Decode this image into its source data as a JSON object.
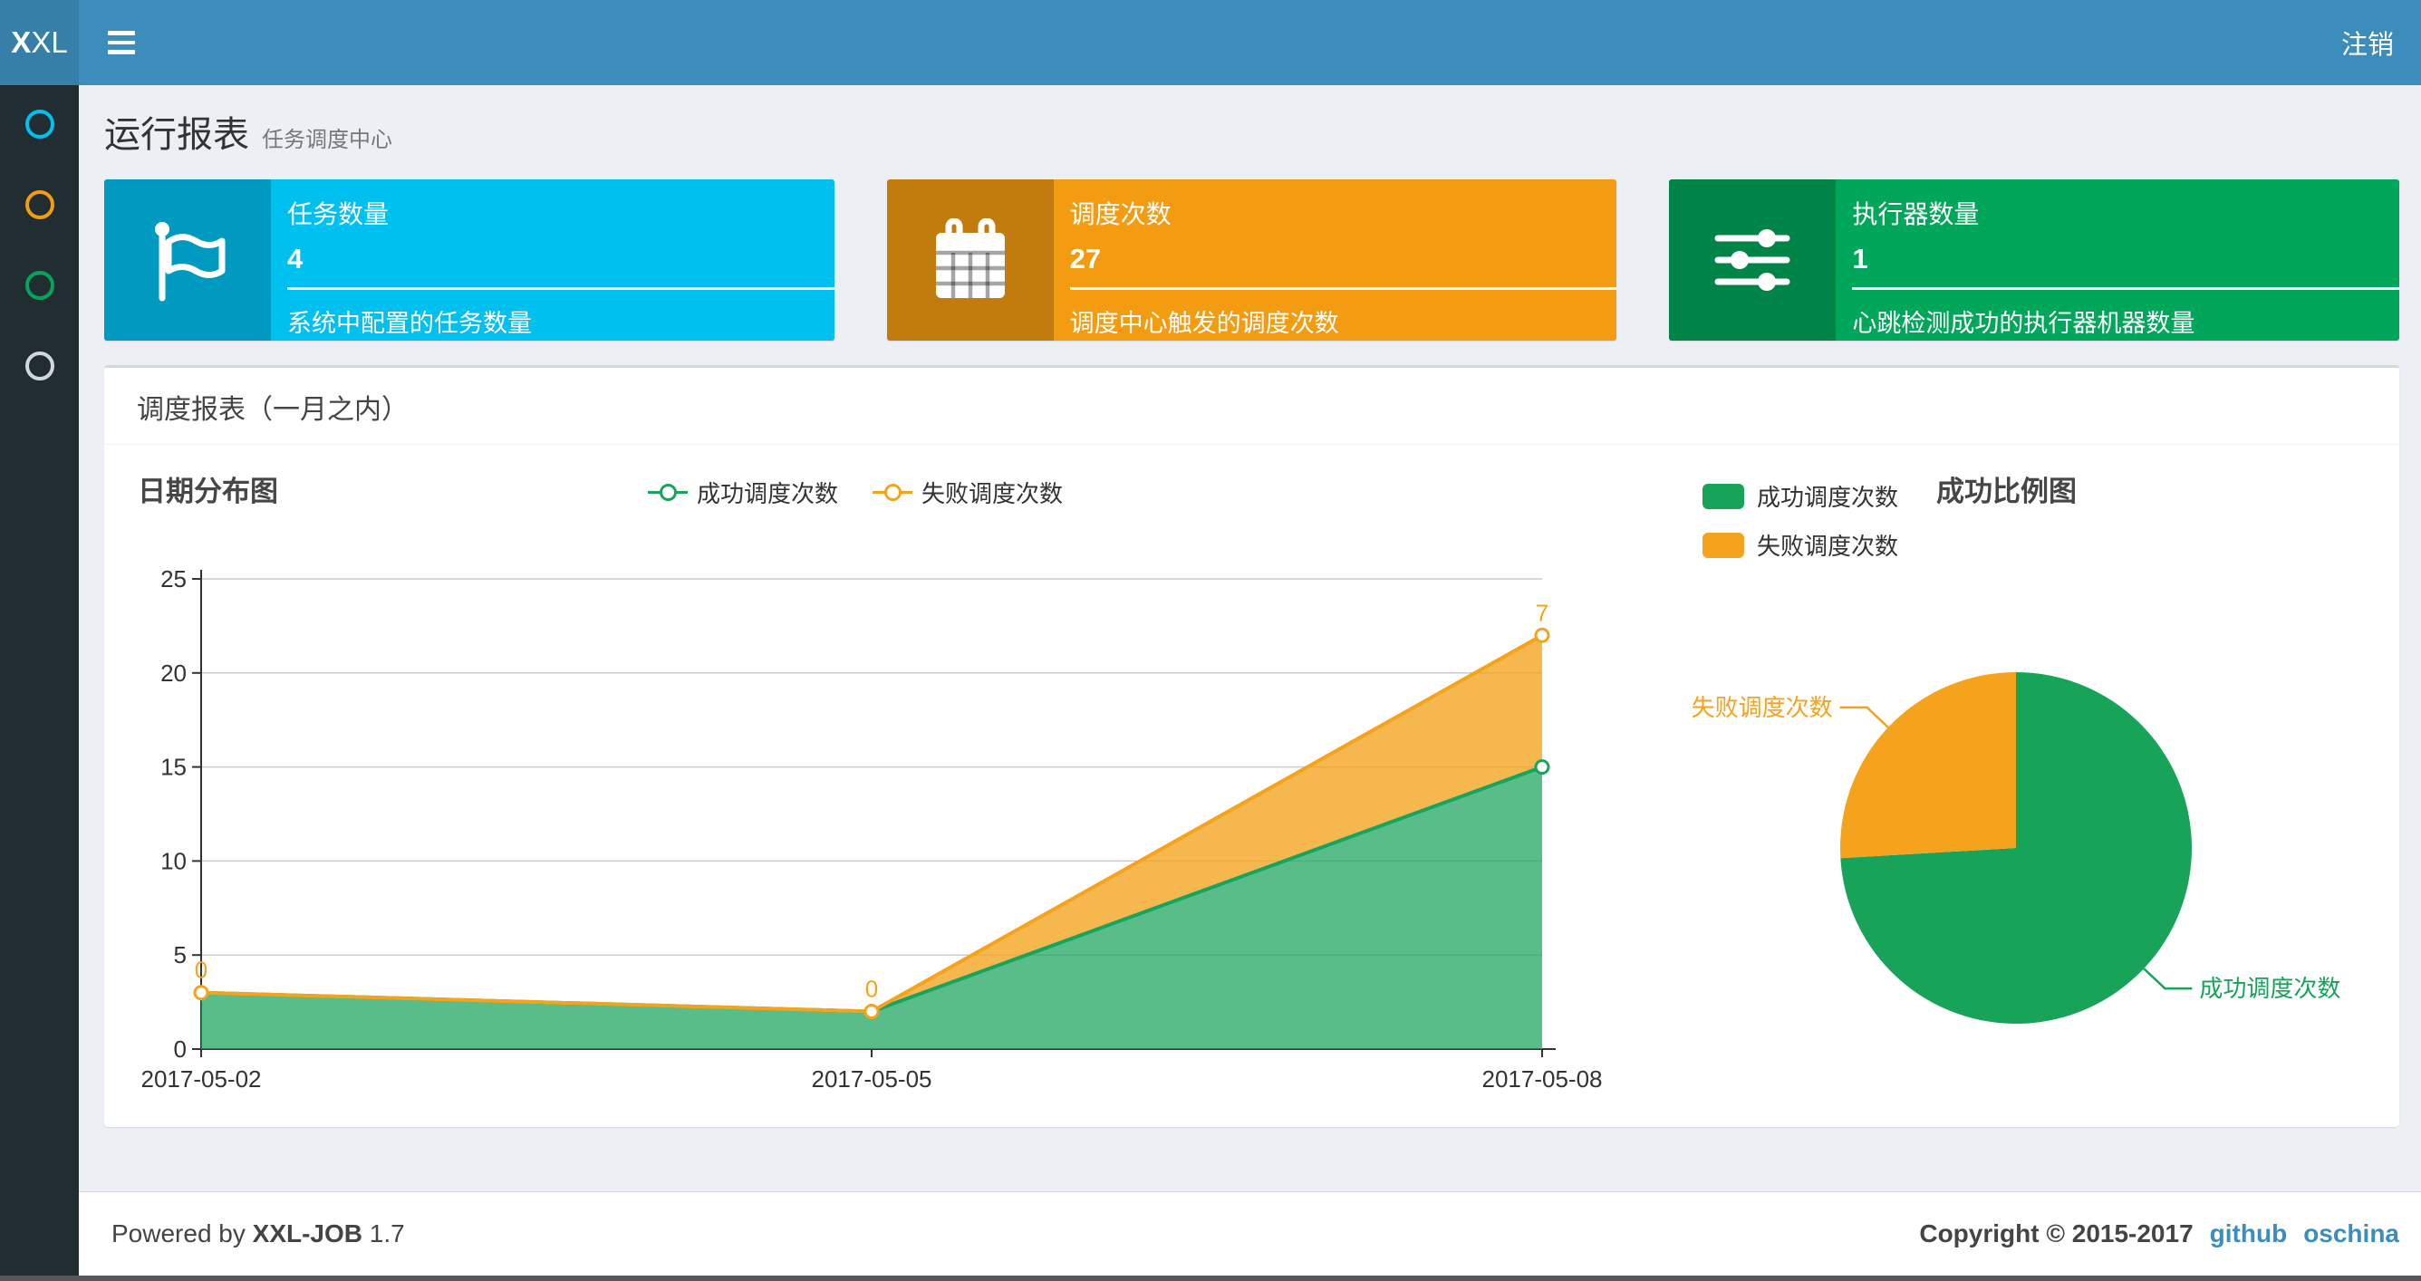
{
  "navbar": {
    "logo_bold": "X",
    "logo_rest": "XL",
    "logout_label": "注销"
  },
  "sidebar": {
    "items": [
      {
        "name": "menu-report",
        "color": "#00c0ef"
      },
      {
        "name": "menu-jobs",
        "color": "#f39c12"
      },
      {
        "name": "menu-logs",
        "color": "#00a65a"
      },
      {
        "name": "menu-executors",
        "color": "#d2d6de"
      }
    ]
  },
  "page_header": {
    "title": "运行报表",
    "subtitle": "任务调度中心"
  },
  "stat_boxes": [
    {
      "icon": "flag-icon",
      "label": "任务数量",
      "value": "4",
      "desc": "系统中配置的任务数量",
      "color": "#00c0ef"
    },
    {
      "icon": "calendar-icon",
      "label": "调度次数",
      "value": "27",
      "desc": "调度中心触发的调度次数",
      "color": "#f39c12"
    },
    {
      "icon": "sliders-icon",
      "label": "执行器数量",
      "value": "1",
      "desc": "心跳检测成功的执行器机器数量",
      "color": "#00a65a"
    }
  ],
  "panel": {
    "title": "调度报表（一月之内）"
  },
  "chart_data": [
    {
      "type": "area",
      "title": "日期分布图",
      "stacked": true,
      "categories": [
        "2017-05-02",
        "2017-05-05",
        "2017-05-08"
      ],
      "series": [
        {
          "name": "成功调度次数",
          "values": [
            3,
            2,
            15
          ],
          "color": "#18a45c",
          "fill_opacity": 0.72
        },
        {
          "name": "失败调度次数",
          "values": [
            0,
            0,
            7
          ],
          "color": "#f5a31d",
          "fill_opacity": 0.78
        }
      ],
      "point_labels": {
        "series": "失败调度次数",
        "values": [
          "0",
          "0",
          "7"
        ]
      },
      "xlabel": "",
      "ylabel": "",
      "ylim": [
        0,
        25
      ],
      "ytick_step": 5,
      "grid": true,
      "legend_position": "top"
    },
    {
      "type": "pie",
      "title": "成功比例图",
      "slices": [
        {
          "name": "成功调度次数",
          "value": 20,
          "color": "#17a358"
        },
        {
          "name": "失败调度次数",
          "value": 7,
          "color": "#f5a31d"
        }
      ],
      "legend_position": "top-left"
    }
  ],
  "footer": {
    "powered_prefix": "Powered by",
    "product": "XXL-JOB",
    "version": "1.7",
    "copyright": "Copyright © 2015-2017",
    "links": [
      {
        "label": "github"
      },
      {
        "label": "oschina"
      }
    ]
  },
  "theme": {
    "navbar_bg": "#3c8dbc",
    "logo_bg": "#367fa9",
    "sidebar_bg": "#222d32",
    "content_bg": "#ecf0f5",
    "panel_border": "#d2d6de",
    "link_color": "#3c8dbc",
    "bottom_strip": "#54585a"
  }
}
